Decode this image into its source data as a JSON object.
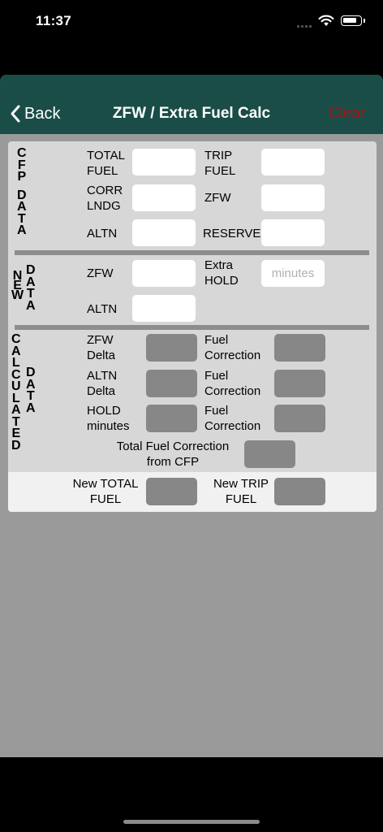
{
  "status": {
    "time": "11:37"
  },
  "nav": {
    "back_label": "Back",
    "title": "ZFW / Extra Fuel Calc",
    "clear_label": "Clear"
  },
  "colors": {
    "nav_bg": "#1a4d48",
    "clear": "#b01010",
    "panel": "#d7d7d7",
    "output_box": "#878787",
    "result_band": "#f1f1f1"
  },
  "sections": {
    "cfp": {
      "letters_1": [
        "C",
        "F",
        "P"
      ],
      "letters_2": [
        "D",
        "A",
        "T",
        "A"
      ]
    },
    "new": {
      "letters_1": [
        "N",
        "E",
        "W"
      ],
      "letters_2": [
        "D",
        "A",
        "T",
        "A"
      ]
    },
    "calculated": {
      "letters_1": [
        "C",
        "A",
        "L",
        "C",
        "U",
        "L",
        "A",
        "T",
        "E",
        "D"
      ],
      "letters_2": [
        "D",
        "A",
        "T",
        "A"
      ]
    }
  },
  "cfp_data": {
    "total_fuel": {
      "line1": "TOTAL",
      "line2": "FUEL",
      "value": ""
    },
    "trip_fuel": {
      "line1": "TRIP",
      "line2": "FUEL",
      "value": ""
    },
    "corr_lndg": {
      "line1": "CORR",
      "line2": "LNDG",
      "value": ""
    },
    "zfw": {
      "label": "ZFW",
      "value": ""
    },
    "altn": {
      "label": "ALTN",
      "value": ""
    },
    "reserve": {
      "label": "RESERVE",
      "value": ""
    }
  },
  "new_data": {
    "zfw": {
      "label": "ZFW",
      "value": ""
    },
    "extra_hold": {
      "line1": "Extra",
      "line2": "HOLD",
      "placeholder": "minutes",
      "value": ""
    },
    "altn": {
      "label": "ALTN",
      "value": ""
    }
  },
  "calculated": {
    "zfw_delta": {
      "line1": "ZFW",
      "line2": "Delta"
    },
    "altn_delta": {
      "line1": "ALTN",
      "line2": "Delta"
    },
    "hold_minutes": {
      "line1": "HOLD",
      "line2": "minutes"
    },
    "fuel_correction": {
      "line1": "Fuel",
      "line2": "Correction"
    },
    "total_fuel_correction": {
      "line1": "Total Fuel Correction",
      "line2": "from CFP"
    }
  },
  "results": {
    "new_total_fuel": {
      "line1": "New TOTAL",
      "line2": "FUEL"
    },
    "new_trip_fuel": {
      "line1": "New TRIP",
      "line2": "FUEL"
    }
  }
}
